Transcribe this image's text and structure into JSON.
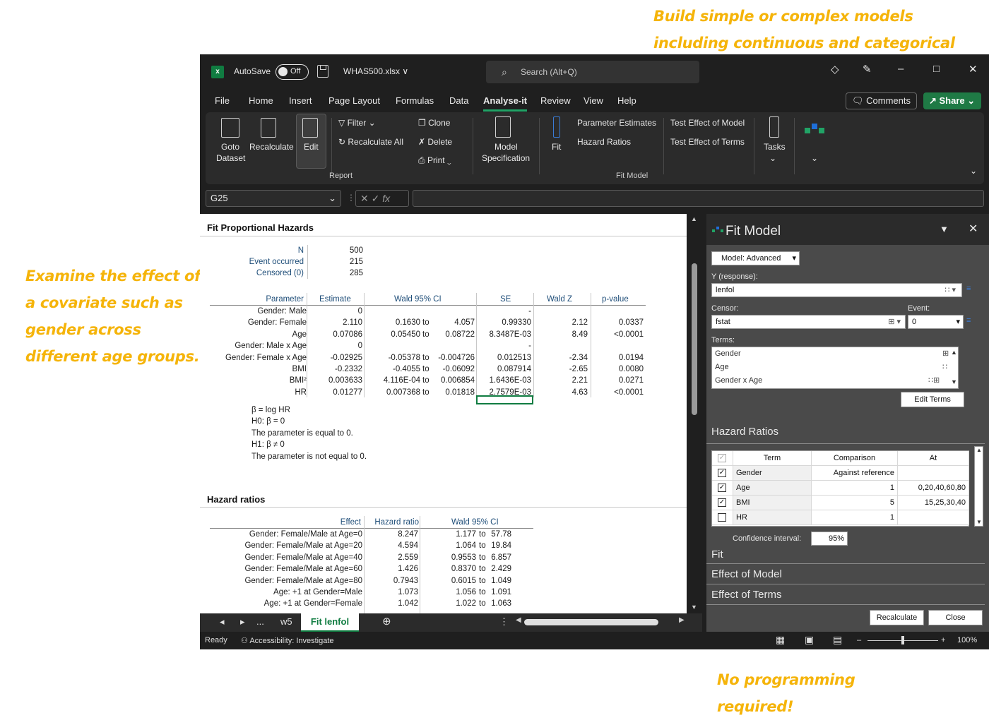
{
  "annotations": {
    "top": "Build simple or complex models including continuous and categorical covariates",
    "left": "Examine the effect of a covariate such as gender across different age groups.",
    "bottom": "No programming required!"
  },
  "titlebar": {
    "autosave_label": "AutoSave",
    "autosave_state": "Off",
    "filename": "WHAS500.xlsx ∨",
    "search_placeholder": "Search (Alt+Q)"
  },
  "menu": {
    "items": [
      "File",
      "Home",
      "Insert",
      "Page Layout",
      "Formulas",
      "Data",
      "Analyse-it",
      "Review",
      "View",
      "Help"
    ],
    "active": "Analyse-it",
    "comments": "Comments",
    "share": "Share"
  },
  "ribbon": {
    "goto_dataset": "Goto",
    "goto_dataset2": "Dataset",
    "recalculate": "Recalculate",
    "edit": "Edit",
    "filter": "Filter",
    "recalculate_all": "Recalculate All",
    "print": "Print",
    "clone": "Clone",
    "delete": "Delete",
    "report_group": "Report",
    "model_spec": "Model",
    "model_spec2": "Specification",
    "fit": "Fit",
    "parameter_estimates": "Parameter Estimates",
    "hazard_ratios": "Hazard Ratios",
    "test_effect_model": "Test Effect of Model",
    "test_effect_terms": "Test Effect of Terms",
    "fit_model_group": "Fit Model",
    "tasks": "Tasks"
  },
  "formula_bar": {
    "namebox": "G25",
    "fx": "fx",
    "value": ""
  },
  "sheet": {
    "title": "Fit Proportional Hazards",
    "summary": [
      {
        "label": "N",
        "value": "500"
      },
      {
        "label": "Event occurred",
        "value": "215"
      },
      {
        "label": "Censored (0)",
        "value": "285"
      }
    ],
    "param_headers": [
      "Parameter",
      "Estimate",
      "Wald 95% CI",
      "SE",
      "Wald Z",
      "p-value"
    ],
    "params": [
      {
        "name": "Gender: Male",
        "est": "0",
        "lo": "",
        "to": "",
        "hi": "",
        "se": "-",
        "z": "",
        "p": ""
      },
      {
        "name": "Gender: Female",
        "est": "2.110",
        "lo": "0.1630",
        "to": "to",
        "hi": "4.057",
        "se": "0.99330",
        "z": "2.12",
        "p": "0.0337"
      },
      {
        "name": "Age",
        "est": "0.07086",
        "lo": "0.05450",
        "to": "to",
        "hi": "0.08722",
        "se": "8.3487E-03",
        "z": "8.49",
        "p": "<0.0001"
      },
      {
        "name": "Gender: Male x Age",
        "est": "0",
        "lo": "",
        "to": "",
        "hi": "",
        "se": "-",
        "z": "",
        "p": ""
      },
      {
        "name": "Gender: Female x Age",
        "est": "-0.02925",
        "lo": "-0.05378",
        "to": "to",
        "hi": "-0.004726",
        "se": "0.012513",
        "z": "-2.34",
        "p": "0.0194"
      },
      {
        "name": "BMI",
        "est": "-0.2332",
        "lo": "-0.4055",
        "to": "to",
        "hi": "-0.06092",
        "se": "0.087914",
        "z": "-2.65",
        "p": "0.0080"
      },
      {
        "name": "BMI²",
        "est": "0.003633",
        "lo": "4.116E-04",
        "to": "to",
        "hi": "0.006854",
        "se": "1.6436E-03",
        "z": "2.21",
        "p": "0.0271"
      },
      {
        "name": "HR",
        "est": "0.01277",
        "lo": "0.007368",
        "to": "to",
        "hi": "0.01818",
        "se": "2.7579E-03",
        "z": "4.63",
        "p": "<0.0001"
      }
    ],
    "notes": [
      "β = log HR",
      "H0: β = 0",
      "The parameter is equal to 0.",
      "H1: β ≠ 0",
      "The parameter is not equal to 0."
    ],
    "hr_title": "Hazard ratios",
    "hr_headers": [
      "Effect",
      "Hazard ratio",
      "Wald 95% CI"
    ],
    "hr_rows": [
      {
        "effect": "Gender: Female/Male at Age=0",
        "hr": "8.247",
        "lo": "1.177",
        "hi": "57.78"
      },
      {
        "effect": "Gender: Female/Male at Age=20",
        "hr": "4.594",
        "lo": "1.064",
        "hi": "19.84"
      },
      {
        "effect": "Gender: Female/Male at Age=40",
        "hr": "2.559",
        "lo": "0.9553",
        "hi": "6.857"
      },
      {
        "effect": "Gender: Female/Male at Age=60",
        "hr": "1.426",
        "lo": "0.8370",
        "hi": "2.429"
      },
      {
        "effect": "Gender: Female/Male at Age=80",
        "hr": "0.7943",
        "lo": "0.6015",
        "hi": "1.049"
      },
      {
        "effect": "Age: +1 at Gender=Male",
        "hr": "1.073",
        "lo": "1.056",
        "hi": "1.091"
      },
      {
        "effect": "Age: +1 at Gender=Female",
        "hr": "1.042",
        "lo": "1.022",
        "hi": "1.063"
      }
    ]
  },
  "tabs": {
    "more": "...",
    "prev_sheet": "w5",
    "active": "Fit lenfol"
  },
  "status": {
    "ready": "Ready",
    "accessibility": "Accessibility: Investigate",
    "zoom": "100%"
  },
  "pane": {
    "title": "Fit Model",
    "model_select": "Model: Advanced",
    "y_label": "Y (response):",
    "y_value": "lenfol",
    "censor_label": "Censor:",
    "censor_value": "fstat",
    "event_label": "Event:",
    "event_value": "0",
    "terms_label": "Terms:",
    "terms": [
      "Gender",
      "Age",
      "Gender x Age"
    ],
    "edit_terms": "Edit Terms",
    "hazard_ratios_section": "Hazard Ratios",
    "hr_headers": [
      "Term",
      "Comparison",
      "At"
    ],
    "hr_rows": [
      {
        "checked": true,
        "term": "Gender",
        "comparison": "Against reference",
        "at": ""
      },
      {
        "checked": true,
        "term": "Age",
        "comparison": "1",
        "at": "0,20,40,60,80"
      },
      {
        "checked": true,
        "term": "BMI",
        "comparison": "5",
        "at": "15,25,30,40"
      },
      {
        "checked": false,
        "term": "HR",
        "comparison": "1",
        "at": ""
      }
    ],
    "ci_label": "Confidence interval:",
    "ci_value": "95%",
    "fit_section": "Fit",
    "effect_model_section": "Effect of Model",
    "effect_terms_section": "Effect of Terms",
    "recalculate": "Recalculate",
    "close": "Close"
  }
}
